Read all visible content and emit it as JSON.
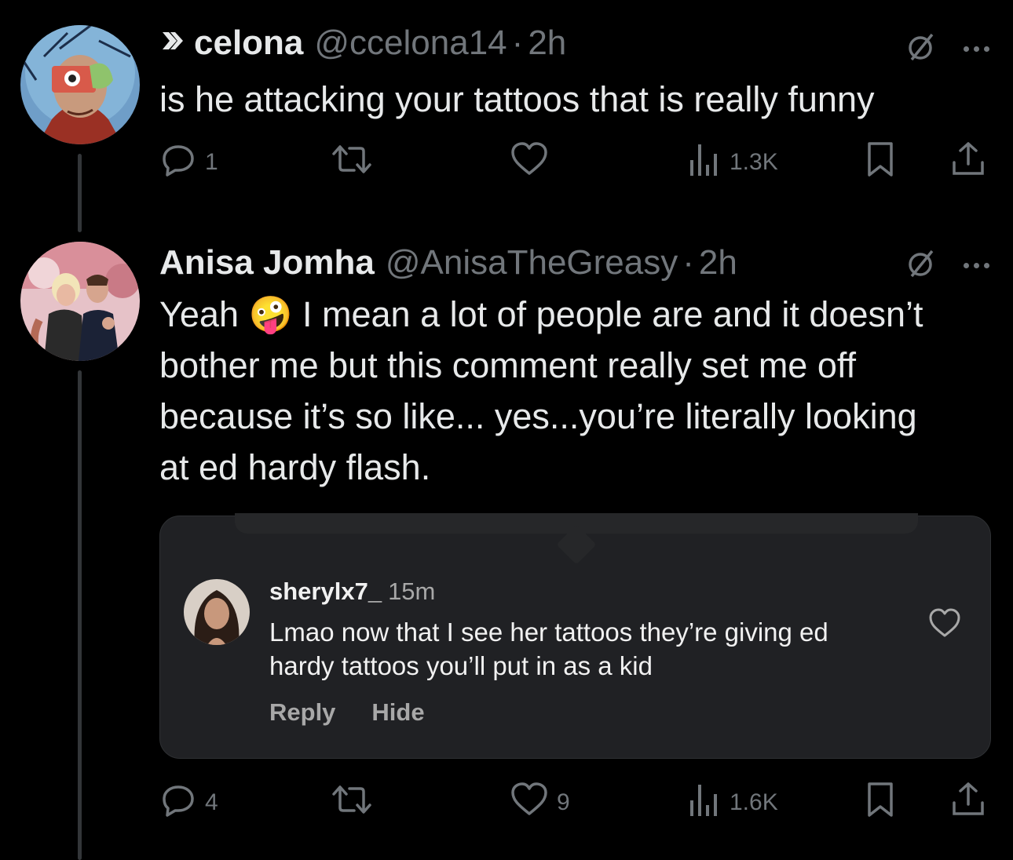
{
  "tweets": [
    {
      "name": "celona",
      "handle": "@ccelona14",
      "separator": "·",
      "time": "2h",
      "text": "is he attacking your tattoos that is really funny",
      "replies": "1",
      "retweets": "",
      "likes": "",
      "views": "1.3K"
    },
    {
      "name": "Anisa Jomha",
      "handle": "@AnisaTheGreasy",
      "separator": "·",
      "time": "2h",
      "text_before_emoji": "Yeah ",
      "emoji": "🤪",
      "text_after_emoji": " I mean a lot of people are and it doesn’t bother me but this comment really set me off because it’s so like... yes...you’re literally looking at ed hardy flash.",
      "replies": "4",
      "retweets": "",
      "likes": "9",
      "views": "1.6K"
    }
  ],
  "embed": {
    "username": "sherylx7_",
    "time": "15m",
    "comment": "Lmao now that I see her tattoos they’re giving ed hardy tattoos you’ll put in as a kid",
    "reply_label": "Reply",
    "hide_label": "Hide"
  },
  "icons": {
    "reply": "reply-icon",
    "retweet": "retweet-icon",
    "like": "heart-icon",
    "views": "views-icon",
    "bookmark": "bookmark-icon",
    "share": "share-icon",
    "grok": "grok-icon",
    "more": "more-icon",
    "verified_arrow": "arrow-icon"
  },
  "colors": {
    "background": "#000000",
    "text": "#e7e9ea",
    "secondary": "#71767b",
    "embed_background": "#202124"
  }
}
